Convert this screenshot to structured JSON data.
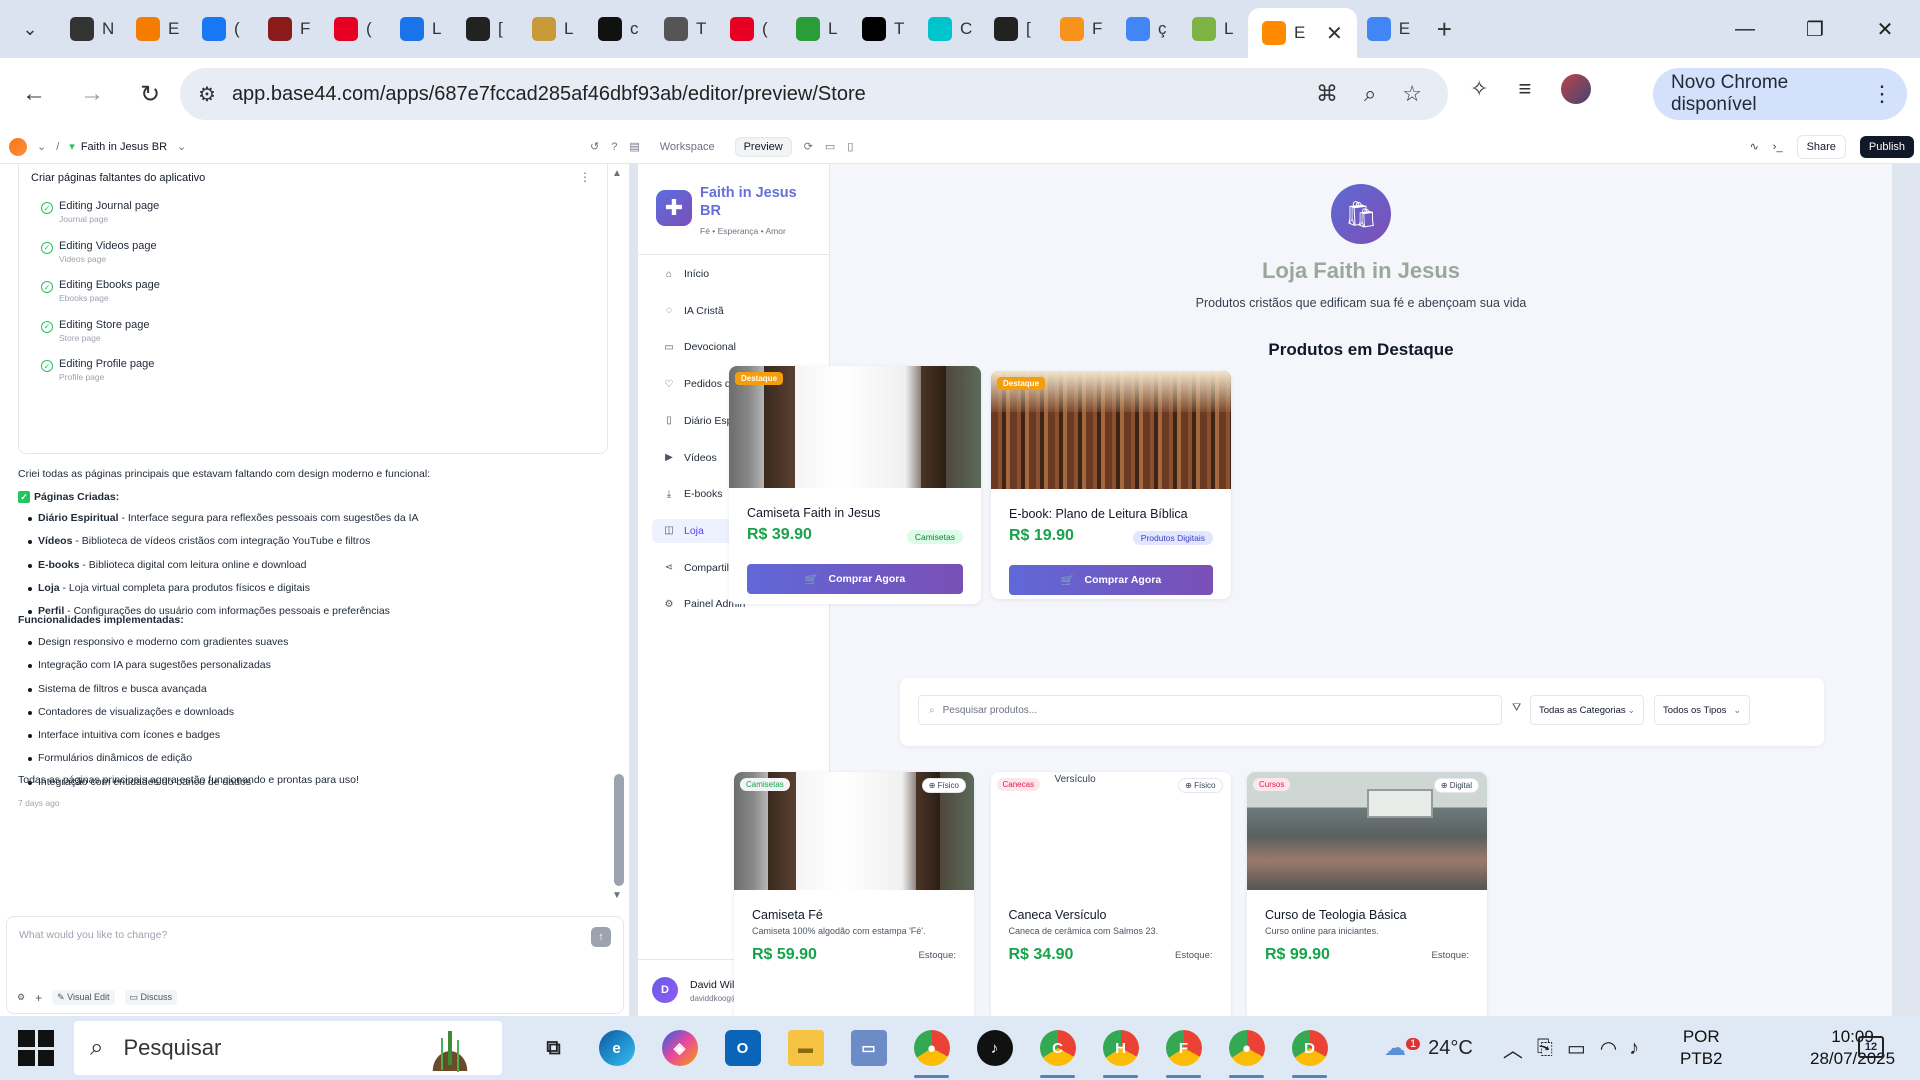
{
  "browser": {
    "tabs": [
      {
        "label": "N",
        "icon": "github-icon",
        "color": "#333"
      },
      {
        "label": "E",
        "icon": "blogger-icon",
        "color": "#f57c00"
      },
      {
        "label": "(",
        "icon": "facebook-icon",
        "color": "#1877f2"
      },
      {
        "label": "F",
        "icon": "book-icon",
        "color": "#8b1a1a"
      },
      {
        "label": "(",
        "icon": "pinterest-icon",
        "color": "#e60023"
      },
      {
        "label": "L",
        "icon": "app-icon",
        "color": "#1a73e8"
      },
      {
        "label": "[",
        "icon": "dn-ai-icon",
        "color": "#222"
      },
      {
        "label": "L",
        "icon": "bread-icon",
        "color": "#c89a3a"
      },
      {
        "label": "c",
        "icon": "capcut-icon",
        "color": "#111"
      },
      {
        "label": "T",
        "icon": "globe-icon",
        "color": "#555"
      },
      {
        "label": "(",
        "icon": "pinterest-icon",
        "color": "#e60023"
      },
      {
        "label": "L",
        "icon": "leaf-icon",
        "color": "#2a9d3a"
      },
      {
        "label": "T",
        "icon": "tiktok-icon",
        "color": "#000"
      },
      {
        "label": "C",
        "icon": "canva-icon",
        "color": "#00c4cc"
      },
      {
        "label": "[",
        "icon": "openai-icon",
        "color": "#222"
      },
      {
        "label": "F",
        "icon": "bitcoin-icon",
        "color": "#f7931a"
      },
      {
        "label": "ç",
        "icon": "google-icon",
        "color": "#4285f4"
      },
      {
        "label": "L",
        "icon": "l-app-icon",
        "color": "#7cb342"
      },
      {
        "label": "E",
        "icon": "base44-icon",
        "color": "#ff8a00",
        "active": true
      },
      {
        "label": "E",
        "icon": "gemini-icon",
        "color": "#4285f4"
      }
    ],
    "url": "app.base44.com/apps/687e7fccad285af46dbf93ab/editor/preview/Store",
    "update_label": "Novo Chrome disponível"
  },
  "app_header": {
    "project": "Faith in Jesus BR",
    "workspace": "Workspace",
    "preview": "Preview",
    "share": "Share",
    "publish": "Publish"
  },
  "chat": {
    "task_title": "Criar páginas faltantes do aplicativo",
    "tasks": [
      {
        "title": "Editing Journal page",
        "sub": "Journal page"
      },
      {
        "title": "Editing Videos page",
        "sub": "Videos page"
      },
      {
        "title": "Editing Ebooks page",
        "sub": "Ebooks page"
      },
      {
        "title": "Editing Store page",
        "sub": "Store page"
      },
      {
        "title": "Editing Profile page",
        "sub": "Profile page"
      }
    ],
    "intro": "Criei todas as páginas principais que estavam faltando com design moderno e funcional:",
    "pages_heading": "Páginas Criadas:",
    "pages": [
      {
        "name": "Diário Espiritual",
        "desc": " - Interface segura para reflexões pessoais com sugestões da IA"
      },
      {
        "name": "Vídeos",
        "desc": " - Biblioteca de vídeos cristãos com integração YouTube e filtros"
      },
      {
        "name": "E-books",
        "desc": " - Biblioteca digital com leitura online e download"
      },
      {
        "name": "Loja",
        "desc": " - Loja virtual completa para produtos físicos e digitais"
      },
      {
        "name": "Perfil",
        "desc": " - Configurações do usuário com informações pessoais e preferências"
      }
    ],
    "features_heading": "Funcionalidades implementadas:",
    "features": [
      "Design responsivo e moderno com gradientes suaves",
      "Integração com IA para sugestões personalizadas",
      "Sistema de filtros e busca avançada",
      "Contadores de visualizações e downloads",
      "Interface intuitiva com ícones e badges",
      "Formulários dinâmicos de edição",
      "Integração com entidades do banco de dados"
    ],
    "outro": "Todas as páginas principais agora estão funcionando e prontas para uso!",
    "time_ago": "7 days ago",
    "composer_placeholder": "What would you like to change?",
    "visual_edit": "Visual Edit",
    "discuss": "Discuss"
  },
  "sidebar": {
    "brand_name": "Faith in Jesus BR",
    "brand_tagline": "Fé • Esperança • Amor",
    "items": [
      {
        "label": "Início",
        "icon": "home-icon",
        "glyph": "⌂"
      },
      {
        "label": "IA Cristã",
        "icon": "chat-icon",
        "glyph": "◌"
      },
      {
        "label": "Devocional",
        "icon": "book-icon",
        "glyph": "▭"
      },
      {
        "label": "Pedidos de Oração",
        "icon": "heart-icon",
        "glyph": "♡"
      },
      {
        "label": "Diário Espiritual",
        "icon": "open-book-icon",
        "glyph": "▯"
      },
      {
        "label": "Vídeos",
        "icon": "video-icon",
        "glyph": "▶"
      },
      {
        "label": "E-books",
        "icon": "download-icon",
        "glyph": "⤓"
      },
      {
        "label": "Loja",
        "icon": "bag-icon",
        "glyph": "◫",
        "active": true
      },
      {
        "label": "Compartilhar",
        "icon": "share-icon",
        "glyph": "⋖"
      },
      {
        "label": "Painel Admin",
        "icon": "settings-icon",
        "glyph": "⚙"
      }
    ],
    "user_initial": "D",
    "user_name": "David Wilson",
    "user_email": "daviddkoog@gmail.com"
  },
  "store": {
    "title": "Loja Faith in Jesus",
    "subtitle": "Produtos cristãos que edificam sua fé e abençoam sua vida",
    "featured_heading": "Produtos em Destaque",
    "featured": [
      {
        "badge": "Destaque",
        "name": "Camiseta Faith in Jesus",
        "price": "R$ 39.90",
        "tag": "Camisetas",
        "button": "Comprar Agora"
      },
      {
        "badge": "Destaque",
        "name": "E-book: Plano de Leitura Bíblica",
        "price": "R$ 19.90",
        "tag": "Produtos Digitais",
        "button": "Comprar Agora"
      }
    ],
    "search_placeholder": "Pesquisar produtos...",
    "category_filter": "Todas as Categorias",
    "type_filter": "Todos os Tipos",
    "products": [
      {
        "category": "Camisetas",
        "type": "Físico",
        "name": "Camiseta Fé",
        "desc": "Camiseta 100% algodão com estampa 'Fé'.",
        "price": "R$ 59.90",
        "stock": "Estoque:"
      },
      {
        "category": "Canecas",
        "type": "Físico",
        "alt": "Versículo",
        "name": "Caneca Versículo",
        "desc": "Caneca de cerâmica com Salmos 23.",
        "price": "R$ 34.90",
        "stock": "Estoque:"
      },
      {
        "category": "Cursos",
        "type": "Digital",
        "name": "Curso de Teologia Básica",
        "desc": "Curso online para iniciantes.",
        "price": "R$ 99.90",
        "stock": "Estoque:"
      }
    ]
  },
  "taskbar": {
    "search": "Pesquisar",
    "temperature": "24°C",
    "weather_badge": "1",
    "lang1": "POR",
    "lang2": "PTB2",
    "time": "10:09",
    "date": "28/07/2025",
    "notifications": "12"
  }
}
